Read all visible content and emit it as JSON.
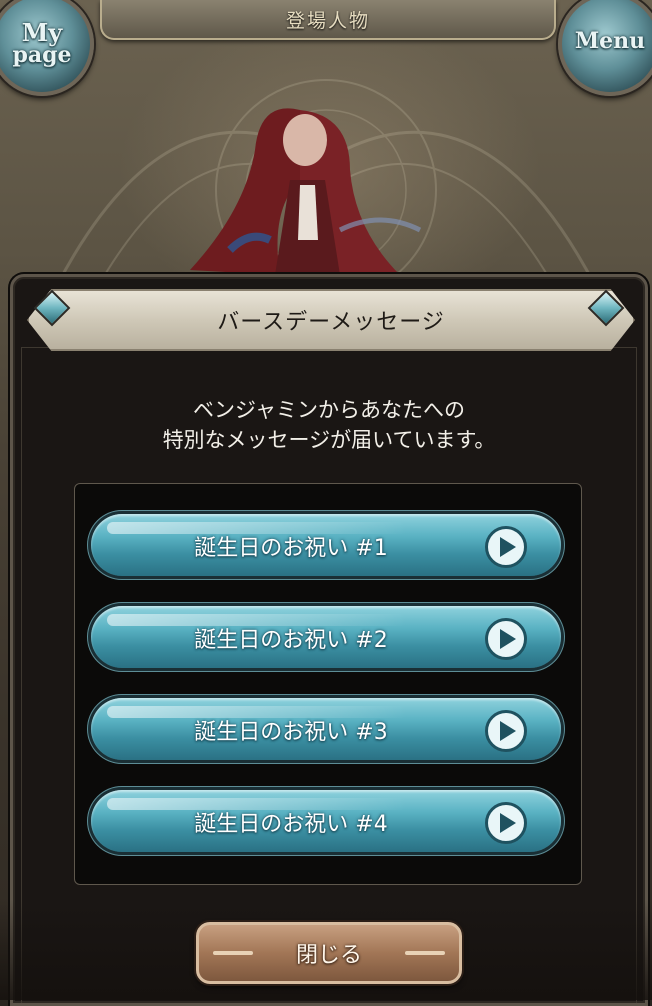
{
  "header": {
    "title": "登場人物",
    "mypage_label_line1": "My",
    "mypage_label_line2": "page",
    "menu_label": "Menu"
  },
  "modal": {
    "title": "バースデーメッセージ",
    "description_line1": "ベンジャミンからあなたへの",
    "description_line2": "特別なメッセージが届いています。",
    "messages": [
      {
        "label": "誕生日のお祝い #1"
      },
      {
        "label": "誕生日のお祝い #2"
      },
      {
        "label": "誕生日のお祝い #3"
      },
      {
        "label": "誕生日のお祝い #4"
      }
    ],
    "close_label": "閉じる"
  },
  "colors": {
    "button_teal": "#4fa6b8",
    "close_bronze": "#a27656",
    "header_parchment": "#d8d1c1"
  },
  "icons": {
    "play": "play-icon",
    "gem": "gem-icon"
  }
}
